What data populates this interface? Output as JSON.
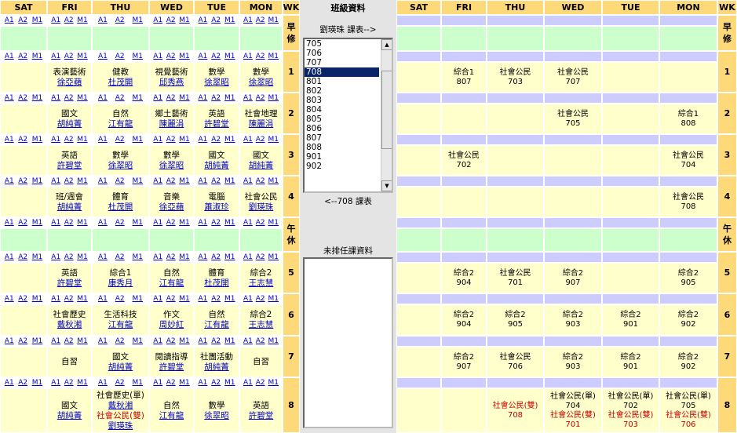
{
  "days": [
    "SAT",
    "FRI",
    "THU",
    "WED",
    "TUE",
    "MON"
  ],
  "wk_label": "WK",
  "links": [
    "A1",
    "A2",
    "M1"
  ],
  "panel": {
    "title": "班級資料",
    "list_title": "劉瑛珠 課表-->",
    "class_list": [
      "705",
      "706",
      "707",
      "708",
      "801",
      "802",
      "803",
      "804",
      "805",
      "806",
      "807",
      "808",
      "901",
      "902"
    ],
    "selected": "708",
    "list_footer": "<--708 課表",
    "unscheduled_title": "未排任課資料"
  },
  "rows": [
    {
      "label": "早修",
      "special": true,
      "left": [
        [],
        [],
        [],
        [],
        [],
        []
      ],
      "right": [
        [],
        [],
        [],
        [],
        [],
        []
      ]
    },
    {
      "label": "1",
      "left": [
        [],
        [
          {
            "t": "表演藝術"
          },
          {
            "t": "徐亞蘋",
            "link": true
          }
        ],
        [
          {
            "t": "健教"
          },
          {
            "t": "杜茂開",
            "link": true
          }
        ],
        [
          {
            "t": "視覺藝術"
          },
          {
            "t": "邱秀燕",
            "link": true
          }
        ],
        [
          {
            "t": "數學"
          },
          {
            "t": "徐翠昭",
            "link": true
          }
        ],
        [
          {
            "t": "數學"
          },
          {
            "t": "徐翠昭",
            "link": true
          }
        ]
      ],
      "right": [
        [],
        [
          {
            "t": "綜合1"
          },
          {
            "t": "807"
          }
        ],
        [
          {
            "t": "社會公民"
          },
          {
            "t": "703"
          }
        ],
        [
          {
            "t": "社會公民"
          },
          {
            "t": "707"
          }
        ],
        [],
        []
      ]
    },
    {
      "label": "2",
      "left": [
        [],
        [
          {
            "t": "國文"
          },
          {
            "t": "胡純菁",
            "link": true
          }
        ],
        [
          {
            "t": "自然"
          },
          {
            "t": "江有龍",
            "link": true
          }
        ],
        [
          {
            "t": "鄉土藝術"
          },
          {
            "t": "陳麗涓",
            "link": true
          }
        ],
        [
          {
            "t": "英語"
          },
          {
            "t": "許碧堂",
            "link": true
          }
        ],
        [
          {
            "t": "社會地理"
          },
          {
            "t": "陳麗涓",
            "link": true
          }
        ]
      ],
      "right": [
        [],
        [],
        [],
        [
          {
            "t": "社會公民"
          },
          {
            "t": "705"
          }
        ],
        [],
        [
          {
            "t": "綜合1"
          },
          {
            "t": "808"
          }
        ]
      ]
    },
    {
      "label": "3",
      "left": [
        [],
        [
          {
            "t": "英語"
          },
          {
            "t": "許碧堂",
            "link": true
          }
        ],
        [
          {
            "t": "數學"
          },
          {
            "t": "徐翠昭",
            "link": true
          }
        ],
        [
          {
            "t": "數學"
          },
          {
            "t": "徐翠昭",
            "link": true
          }
        ],
        [
          {
            "t": "國文"
          },
          {
            "t": "胡純菁",
            "link": true
          }
        ],
        [
          {
            "t": "國文"
          },
          {
            "t": "胡純菁",
            "link": true
          }
        ]
      ],
      "right": [
        [],
        [
          {
            "t": "社會公民"
          },
          {
            "t": "702"
          }
        ],
        [],
        [],
        [],
        [
          {
            "t": "社會公民"
          },
          {
            "t": "704"
          }
        ]
      ]
    },
    {
      "label": "4",
      "left": [
        [],
        [
          {
            "t": "班/週會"
          },
          {
            "t": "胡純菁",
            "link": true
          }
        ],
        [
          {
            "t": "體育"
          },
          {
            "t": "杜茂開",
            "link": true
          }
        ],
        [
          {
            "t": "音樂"
          },
          {
            "t": "徐亞蘋",
            "link": true
          }
        ],
        [
          {
            "t": "電腦"
          },
          {
            "t": "蕭淑珍",
            "link": true
          }
        ],
        [
          {
            "t": "社會公民"
          },
          {
            "t": "劉瑛珠",
            "link": true
          }
        ]
      ],
      "right": [
        [],
        [],
        [],
        [],
        [],
        [
          {
            "t": "社會公民"
          },
          {
            "t": "708"
          }
        ]
      ]
    },
    {
      "label": "午休",
      "special": true,
      "left": [
        [],
        [],
        [],
        [],
        [],
        []
      ],
      "right": [
        [],
        [],
        [],
        [],
        [],
        []
      ]
    },
    {
      "label": "5",
      "left": [
        [],
        [
          {
            "t": "英語"
          },
          {
            "t": "許碧堂",
            "link": true
          }
        ],
        [
          {
            "t": "綜合1"
          },
          {
            "t": "康秀月",
            "link": true
          }
        ],
        [
          {
            "t": "自然"
          },
          {
            "t": "江有龍",
            "link": true
          }
        ],
        [
          {
            "t": "體育"
          },
          {
            "t": "杜茂開",
            "link": true
          }
        ],
        [
          {
            "t": "綜合2"
          },
          {
            "t": "王志慧",
            "link": true
          }
        ]
      ],
      "right": [
        [],
        [
          {
            "t": "綜合2"
          },
          {
            "t": "904"
          }
        ],
        [
          {
            "t": "社會公民"
          },
          {
            "t": "701"
          }
        ],
        [
          {
            "t": "綜合2"
          },
          {
            "t": "907"
          }
        ],
        [],
        [
          {
            "t": "綜合2"
          },
          {
            "t": "905"
          }
        ]
      ]
    },
    {
      "label": "6",
      "left": [
        [],
        [
          {
            "t": "社會歷史"
          },
          {
            "t": "戴秋湘",
            "link": true
          }
        ],
        [
          {
            "t": "生活科技"
          },
          {
            "t": "江有龍",
            "link": true
          }
        ],
        [
          {
            "t": "作文"
          },
          {
            "t": "周妙紅",
            "link": true
          }
        ],
        [
          {
            "t": "自然"
          },
          {
            "t": "江有龍",
            "link": true
          }
        ],
        [
          {
            "t": "綜合2"
          },
          {
            "t": "王志慧",
            "link": true
          }
        ]
      ],
      "right": [
        [],
        [
          {
            "t": "綜合2"
          },
          {
            "t": "904"
          }
        ],
        [
          {
            "t": "綜合2"
          },
          {
            "t": "905"
          }
        ],
        [
          {
            "t": "綜合2"
          },
          {
            "t": "903"
          }
        ],
        [
          {
            "t": "綜合2"
          },
          {
            "t": "901"
          }
        ],
        [
          {
            "t": "綜合2"
          },
          {
            "t": "902"
          }
        ]
      ]
    },
    {
      "label": "7",
      "left": [
        [],
        [
          {
            "t": "自習"
          }
        ],
        [
          {
            "t": "國文"
          },
          {
            "t": "胡純菁",
            "link": true
          }
        ],
        [
          {
            "t": "閱讀指導"
          },
          {
            "t": "許碧堂",
            "link": true
          }
        ],
        [
          {
            "t": "社團活動"
          },
          {
            "t": "胡純菁",
            "link": true
          }
        ],
        [
          {
            "t": "自習"
          }
        ]
      ],
      "right": [
        [],
        [
          {
            "t": "綜合2"
          },
          {
            "t": "907"
          }
        ],
        [
          {
            "t": "社會公民"
          },
          {
            "t": "706"
          }
        ],
        [
          {
            "t": "綜合2"
          },
          {
            "t": "903"
          }
        ],
        [
          {
            "t": "綜合2"
          },
          {
            "t": "901"
          }
        ],
        [
          {
            "t": "綜合2"
          },
          {
            "t": "902"
          }
        ]
      ]
    },
    {
      "label": "8",
      "left": [
        [],
        [
          {
            "t": "國文"
          },
          {
            "t": "胡純菁",
            "link": true
          }
        ],
        [
          {
            "t": "社會歷史(單)"
          },
          {
            "t": "戴秋湘",
            "link": true
          },
          {
            "t": "社會公民(雙)",
            "red": true
          },
          {
            "t": "劉瑛珠",
            "link": true
          }
        ],
        [
          {
            "t": "自然"
          },
          {
            "t": "江有龍",
            "link": true
          }
        ],
        [
          {
            "t": "數學"
          },
          {
            "t": "徐翠昭",
            "link": true
          }
        ],
        [
          {
            "t": "英語"
          },
          {
            "t": "許碧堂",
            "link": true
          }
        ]
      ],
      "right": [
        [],
        [],
        [
          {
            "t": "社會公民(雙)",
            "red": true
          },
          {
            "t": "708",
            "red": true
          }
        ],
        [
          {
            "t": "社會公民(單)"
          },
          {
            "t": "704"
          },
          {
            "t": "社會公民(雙)",
            "red": true
          },
          {
            "t": "701",
            "red": true
          }
        ],
        [
          {
            "t": "社會公民(單)"
          },
          {
            "t": "702"
          },
          {
            "t": "社會公民(雙)",
            "red": true
          },
          {
            "t": "703",
            "red": true
          }
        ],
        [
          {
            "t": "社會公民(單)"
          },
          {
            "t": "705"
          },
          {
            "t": "社會公民(雙)",
            "red": true
          },
          {
            "t": "706",
            "red": true
          }
        ]
      ]
    }
  ]
}
